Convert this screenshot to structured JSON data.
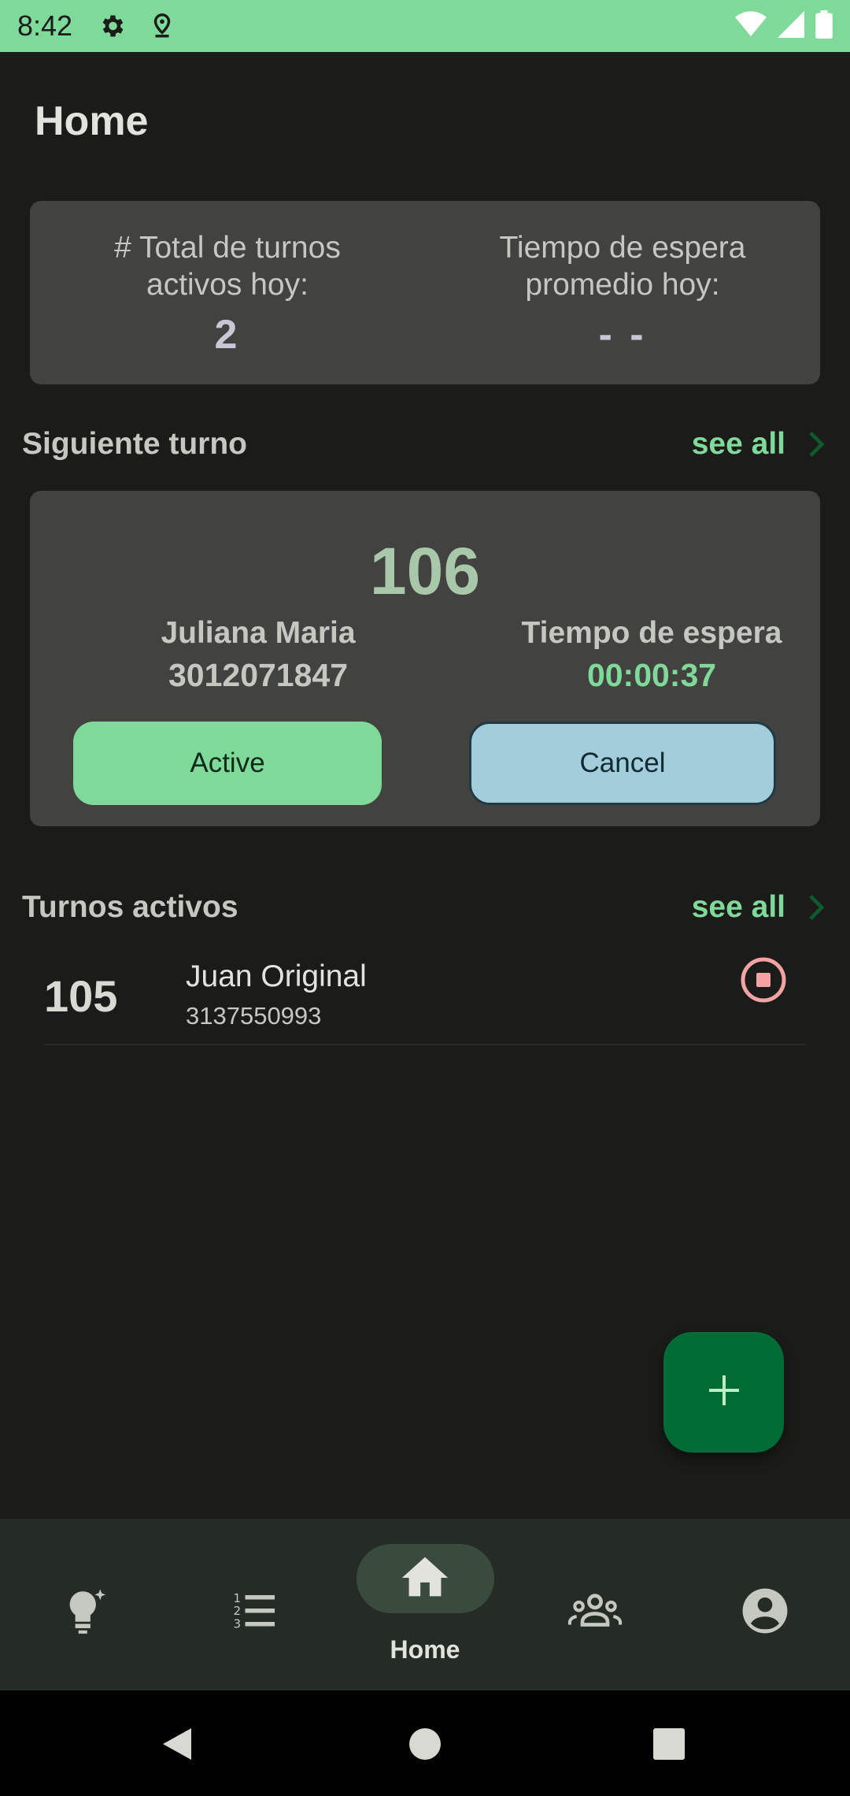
{
  "status_bar": {
    "time": "8:42"
  },
  "header": {
    "title": "Home"
  },
  "stats": {
    "total_label": "# Total de turnos\nactivos hoy:",
    "total_value": "2",
    "wait_label": "Tiempo de espera\npromedio hoy:",
    "wait_value": "- -"
  },
  "next_turn": {
    "section_title": "Siguiente turno",
    "see_all": "see all",
    "number": "106",
    "name": "Juliana Maria",
    "phone": "3012071847",
    "wait_label": "Tiempo de espera",
    "wait_value": "00:00:37",
    "active_label": "Active",
    "cancel_label": "Cancel"
  },
  "active_turns": {
    "section_title": "Turnos activos",
    "see_all": "see all",
    "items": [
      {
        "number": "105",
        "name": "Juan Original",
        "phone": "3137550993"
      }
    ]
  },
  "bottom_nav": {
    "items": [
      {
        "icon": "lightbulb-icon"
      },
      {
        "icon": "list-numbered-icon"
      },
      {
        "icon": "home-icon",
        "label": "Home",
        "selected": true
      },
      {
        "icon": "groups-icon"
      },
      {
        "icon": "account-circle-icon"
      }
    ]
  },
  "colors": {
    "accent": "#7fda9a",
    "background": "#1b1c1a",
    "card": "#424341",
    "fab": "#006c35",
    "cancel": "#a3cdda",
    "stop": "#f4a3a3"
  }
}
